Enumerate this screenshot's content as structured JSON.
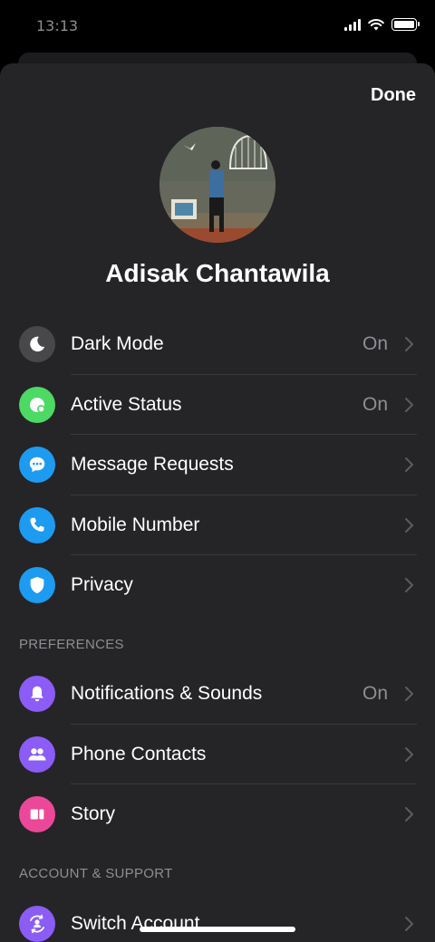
{
  "status_bar": {
    "time": "13:13"
  },
  "header": {
    "done_label": "Done"
  },
  "profile": {
    "name": "Adisak Chantawila"
  },
  "sections": {
    "preferences": "PREFERENCES",
    "account_support": "ACCOUNT & SUPPORT"
  },
  "rows": {
    "dark_mode": {
      "label": "Dark Mode",
      "value": "On",
      "icon": "moon-icon",
      "color": "#48484a"
    },
    "active_status": {
      "label": "Active Status",
      "value": "On",
      "icon": "active-status-icon",
      "color": "#4cd964"
    },
    "message_requests": {
      "label": "Message Requests",
      "icon": "chat-bubble-icon",
      "color": "#1d9bf0"
    },
    "mobile_number": {
      "label": "Mobile Number",
      "icon": "phone-icon",
      "color": "#1d9bf0"
    },
    "privacy": {
      "label": "Privacy",
      "icon": "shield-icon",
      "color": "#1d9bf0"
    },
    "notifications": {
      "label": "Notifications & Sounds",
      "value": "On",
      "icon": "bell-icon",
      "color": "#8b5cf6"
    },
    "phone_contacts": {
      "label": "Phone Contacts",
      "icon": "people-icon",
      "color": "#8b5cf6"
    },
    "story": {
      "label": "Story",
      "icon": "story-icon",
      "color": "#ec4899"
    },
    "switch_account": {
      "label": "Switch Account",
      "icon": "switch-account-icon",
      "color": "#8b5cf6"
    }
  }
}
